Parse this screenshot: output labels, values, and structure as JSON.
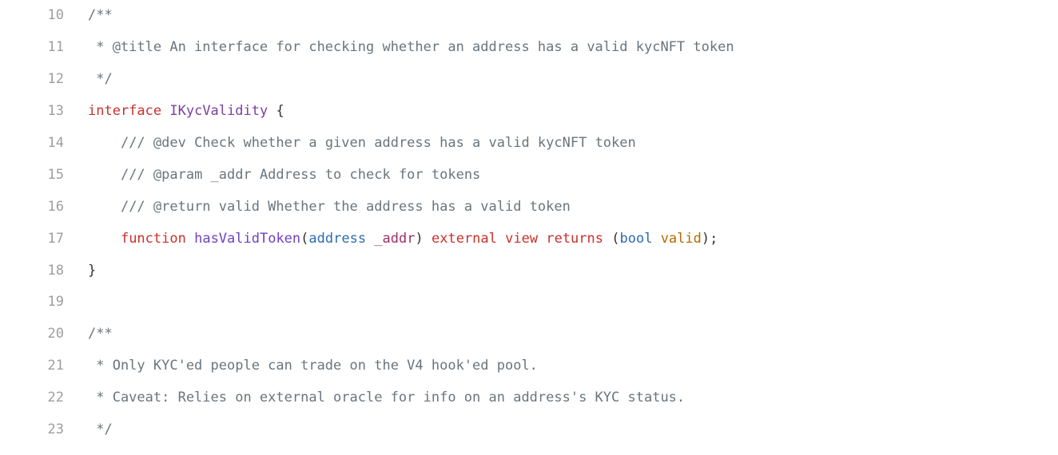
{
  "lines": [
    {
      "n": "10",
      "indent": 0,
      "tokens": [
        {
          "t": "/**",
          "cls": "c"
        }
      ]
    },
    {
      "n": "11",
      "indent": 0,
      "tokens": [
        {
          "t": " * @title An interface for checking whether an address has a valid kycNFT token",
          "cls": "c"
        }
      ]
    },
    {
      "n": "12",
      "indent": 0,
      "tokens": [
        {
          "t": " */",
          "cls": "c"
        }
      ]
    },
    {
      "n": "13",
      "indent": 0,
      "tokens": [
        {
          "t": "interface",
          "cls": "kw"
        },
        {
          "t": " ",
          "cls": "p"
        },
        {
          "t": "IKycValidity",
          "cls": "tn"
        },
        {
          "t": " {",
          "cls": "p"
        }
      ]
    },
    {
      "n": "14",
      "indent": 1,
      "tokens": [
        {
          "t": "/// @dev Check whether a given address has a valid kycNFT token",
          "cls": "c"
        }
      ]
    },
    {
      "n": "15",
      "indent": 1,
      "tokens": [
        {
          "t": "/// @param _addr Address to check for tokens",
          "cls": "c"
        }
      ]
    },
    {
      "n": "16",
      "indent": 1,
      "tokens": [
        {
          "t": "/// @return valid Whether the address has a valid token",
          "cls": "c"
        }
      ]
    },
    {
      "n": "17",
      "indent": 1,
      "tokens": [
        {
          "t": "function",
          "cls": "kw"
        },
        {
          "t": " ",
          "cls": "p"
        },
        {
          "t": "hasValidToken",
          "cls": "fn"
        },
        {
          "t": "(",
          "cls": "p"
        },
        {
          "t": "address",
          "cls": "ty"
        },
        {
          "t": " ",
          "cls": "p"
        },
        {
          "t": "_addr",
          "cls": "pr"
        },
        {
          "t": ")",
          "cls": "p"
        },
        {
          "t": " ",
          "cls": "p"
        },
        {
          "t": "external",
          "cls": "kw"
        },
        {
          "t": " ",
          "cls": "p"
        },
        {
          "t": "view",
          "cls": "kw"
        },
        {
          "t": " ",
          "cls": "p"
        },
        {
          "t": "returns",
          "cls": "kw"
        },
        {
          "t": " (",
          "cls": "p"
        },
        {
          "t": "bool",
          "cls": "ty"
        },
        {
          "t": " ",
          "cls": "p"
        },
        {
          "t": "valid",
          "cls": "id"
        },
        {
          "t": ");",
          "cls": "p"
        }
      ]
    },
    {
      "n": "18",
      "indent": 0,
      "tokens": [
        {
          "t": "}",
          "cls": "p"
        }
      ]
    },
    {
      "n": "19",
      "indent": 0,
      "tokens": [
        {
          "t": "",
          "cls": "p"
        }
      ]
    },
    {
      "n": "20",
      "indent": 0,
      "tokens": [
        {
          "t": "/**",
          "cls": "c"
        }
      ]
    },
    {
      "n": "21",
      "indent": 0,
      "tokens": [
        {
          "t": " * Only KYC'ed people can trade on the V4 hook'ed pool.",
          "cls": "c"
        }
      ]
    },
    {
      "n": "22",
      "indent": 0,
      "tokens": [
        {
          "t": " * Caveat: Relies on external oracle for info on an address's KYC status.",
          "cls": "c"
        }
      ]
    },
    {
      "n": "23",
      "indent": 0,
      "tokens": [
        {
          "t": " */",
          "cls": "c"
        }
      ]
    }
  ],
  "indent_unit": "    "
}
